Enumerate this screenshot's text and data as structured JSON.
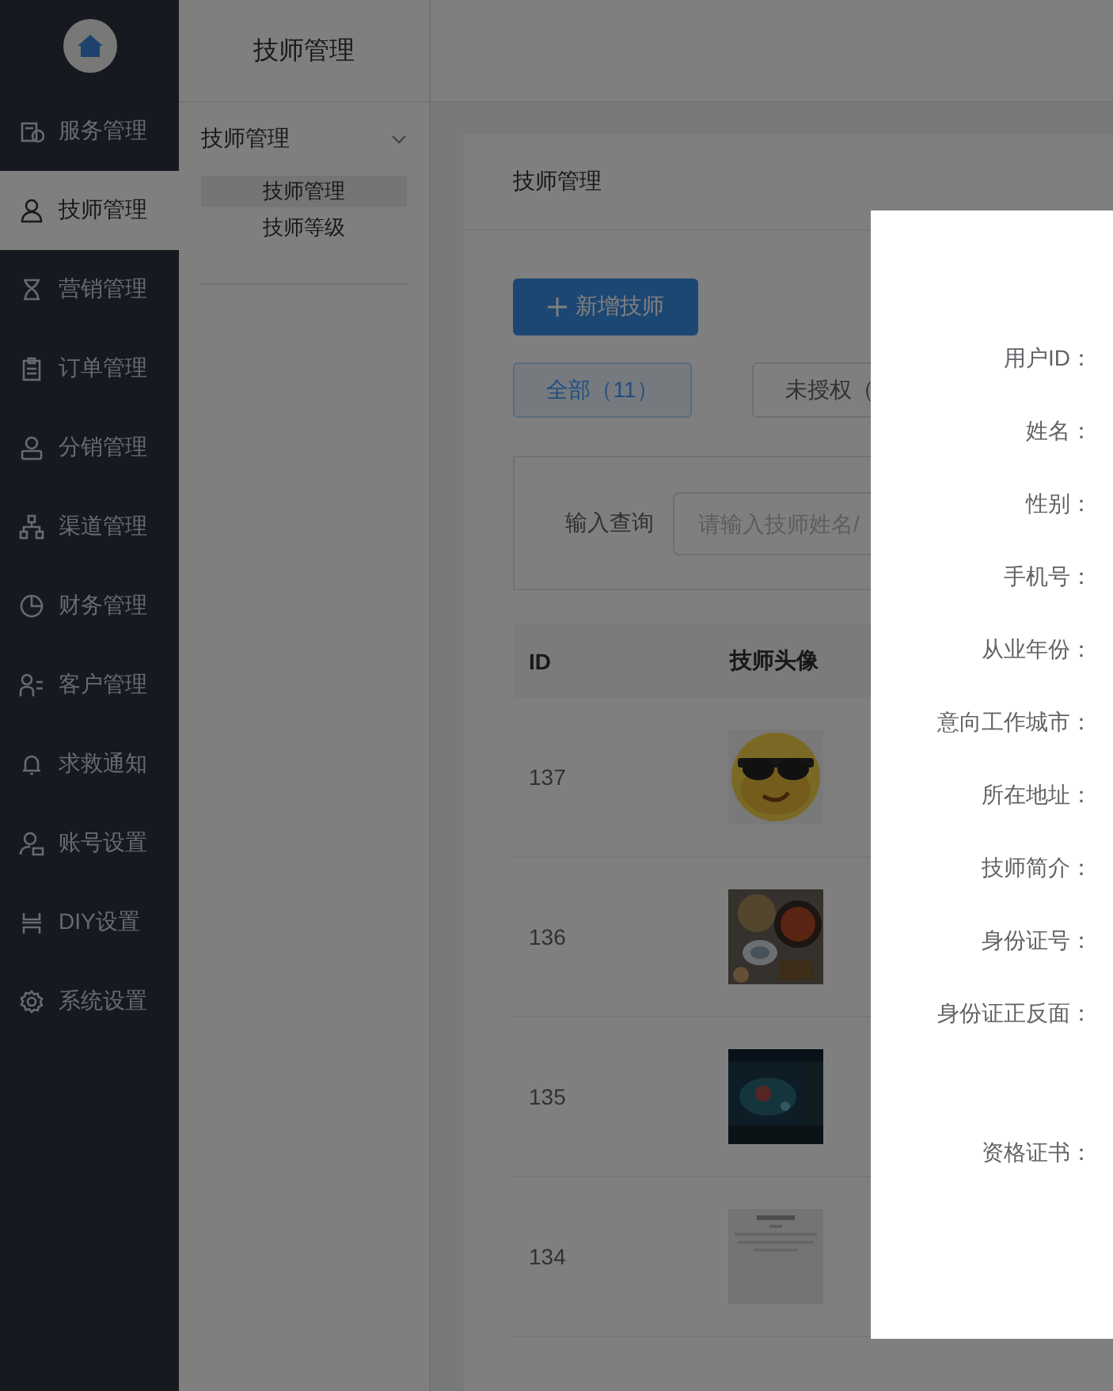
{
  "sidebar": {
    "items": [
      {
        "label": "服务管理",
        "selected": false
      },
      {
        "label": "技师管理",
        "selected": true
      },
      {
        "label": "营销管理",
        "selected": false
      },
      {
        "label": "订单管理",
        "selected": false
      },
      {
        "label": "分销管理",
        "selected": false
      },
      {
        "label": "渠道管理",
        "selected": false
      },
      {
        "label": "财务管理",
        "selected": false
      },
      {
        "label": "客户管理",
        "selected": false
      },
      {
        "label": "求救通知",
        "selected": false
      },
      {
        "label": "账号设置",
        "selected": false
      },
      {
        "label": "DIY设置",
        "selected": false
      },
      {
        "label": "系统设置",
        "selected": false
      }
    ]
  },
  "submenu": {
    "title": "技师管理",
    "groups": [
      {
        "label": "技师管理",
        "expanded": true,
        "children": [
          {
            "label": "技师管理",
            "selected": true
          },
          {
            "label": "技师等级",
            "selected": false
          }
        ]
      }
    ]
  },
  "page": {
    "title": "技师管理",
    "add_button": "新增技师",
    "filters": [
      {
        "label": "全部（11）",
        "selected": true
      },
      {
        "label": "未授权（",
        "selected": false
      }
    ],
    "search": {
      "label": "输入查询",
      "placeholder": "请输入技师姓名/"
    },
    "table": {
      "columns": [
        "ID",
        "技师头像"
      ],
      "rows": [
        {
          "id": "137"
        },
        {
          "id": "136"
        },
        {
          "id": "135"
        },
        {
          "id": "134"
        }
      ]
    }
  },
  "modal": {
    "fields": [
      {
        "label": "用户ID：",
        "kind": "text"
      },
      {
        "label": "姓名：",
        "kind": "text"
      },
      {
        "label": "性别：",
        "kind": "text"
      },
      {
        "label": "手机号：",
        "kind": "text"
      },
      {
        "label": "从业年份：",
        "kind": "text"
      },
      {
        "label": "意向工作城市：",
        "kind": "text"
      },
      {
        "label": "所在地址：",
        "kind": "text"
      },
      {
        "label": "技师简介：",
        "kind": "text"
      },
      {
        "label": "身份证号：",
        "kind": "text"
      },
      {
        "label": "身份证正反面："
      },
      {
        "label": "资格证书："
      }
    ]
  }
}
